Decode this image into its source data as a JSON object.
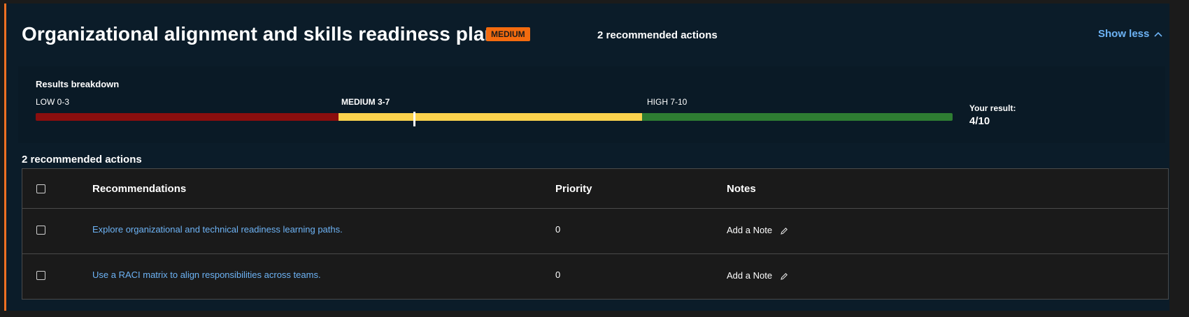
{
  "header": {
    "title": "Organizational alignment and skills readiness plans",
    "badge": "MEDIUM",
    "actions_count": "2 recommended actions",
    "toggle_label": "Show less"
  },
  "breakdown": {
    "title": "Results breakdown",
    "ranges": [
      {
        "label": "LOW 0-3",
        "color": "#8b0e0e"
      },
      {
        "label": "MEDIUM 3-7",
        "color": "#fcd34d"
      },
      {
        "label": "HIGH 7-10",
        "color": "#2e7d32"
      }
    ],
    "result_label": "Your result:",
    "result_value": "4/10",
    "score": 4,
    "max_score": 10
  },
  "recommendations": {
    "section_title": "2 recommended actions",
    "columns": {
      "recommendations": "Recommendations",
      "priority": "Priority",
      "notes": "Notes"
    },
    "rows": [
      {
        "text": "Explore organizational and technical readiness learning paths.",
        "priority": "0",
        "note": "Add a Note"
      },
      {
        "text": "Use a RACI matrix to align responsibilities across teams.",
        "priority": "0",
        "note": "Add a Note"
      }
    ]
  },
  "colors": {
    "accent": "#f07022",
    "link": "#6db3f5",
    "card_background": "#0b1c29"
  },
  "icons": {
    "toggle": "chevron-up-icon",
    "note": "pencil-icon"
  }
}
